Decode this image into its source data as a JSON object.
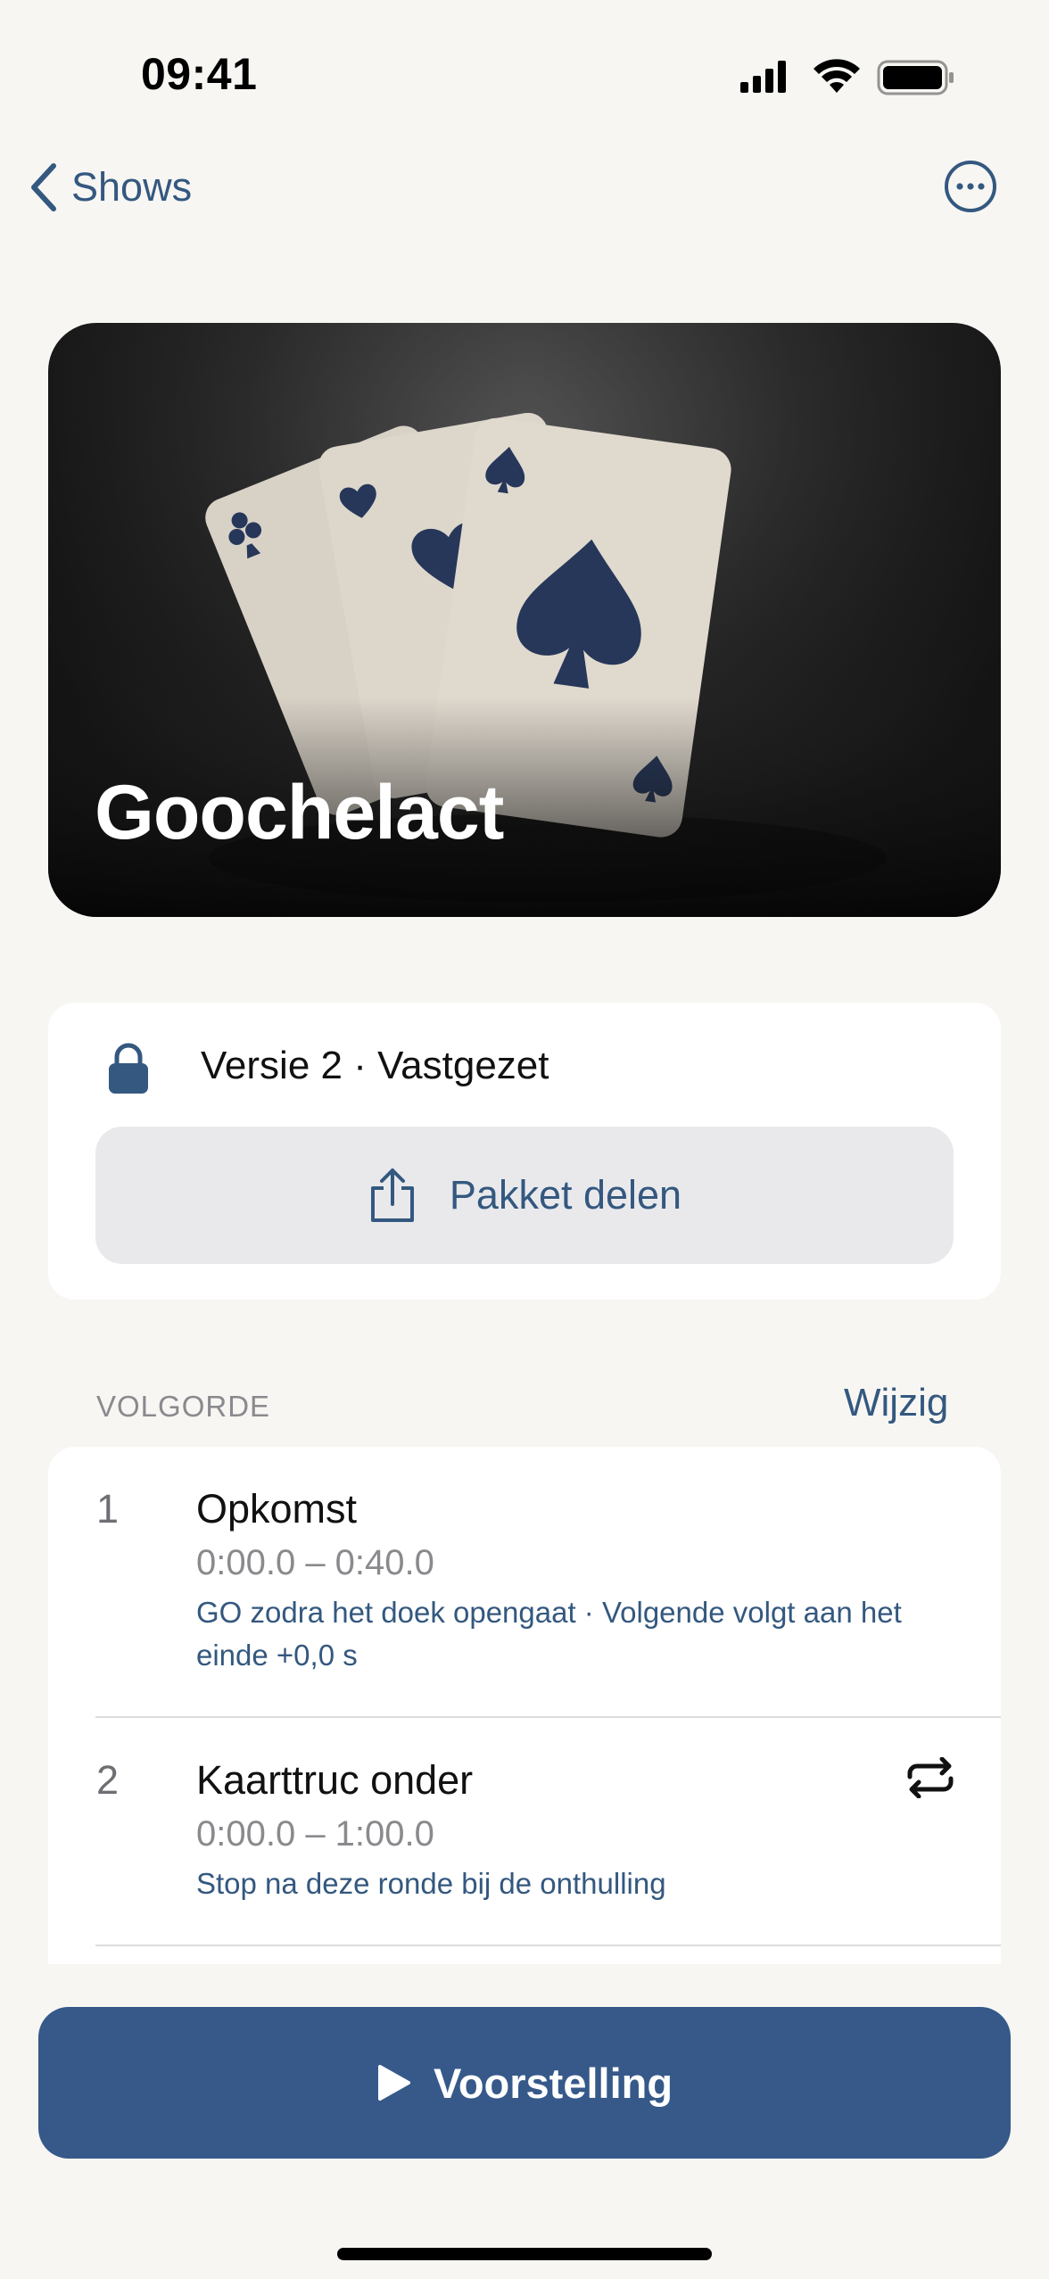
{
  "status_bar": {
    "time": "09:41",
    "icons": [
      "signal-icon",
      "wifi-icon",
      "battery-icon"
    ]
  },
  "nav": {
    "back_label": "Shows",
    "back_icon": "chevron-left-icon",
    "more_icon": "ellipsis-circle-icon"
  },
  "hero": {
    "title": "Goochelact"
  },
  "info": {
    "lock_icon": "lock-icon",
    "version_text": "Versie 2 · Vastgezet",
    "share_label": "Pakket delen",
    "share_icon": "share-icon"
  },
  "sequence": {
    "section_label": "VOLGORDE",
    "edit_label": "Wijzig",
    "items": [
      {
        "number": "1",
        "title": "Opkomst",
        "time_range": "0:00.0 – 0:40.0",
        "note": "GO zodra het doek opengaat · Volgende volgt aan het einde +0,0 s"
      },
      {
        "number": "2",
        "title": "Kaarttruc onder",
        "time_range": "0:00.0 – 1:00.0",
        "note": "Stop na deze ronde bij de onthulling",
        "icon": "repeat-icon"
      }
    ]
  },
  "play_button": {
    "label": "Voorstelling",
    "icon": "play-icon"
  },
  "colors": {
    "accent": "#34587f",
    "button": "#36598a",
    "background": "#f7f6f3"
  }
}
